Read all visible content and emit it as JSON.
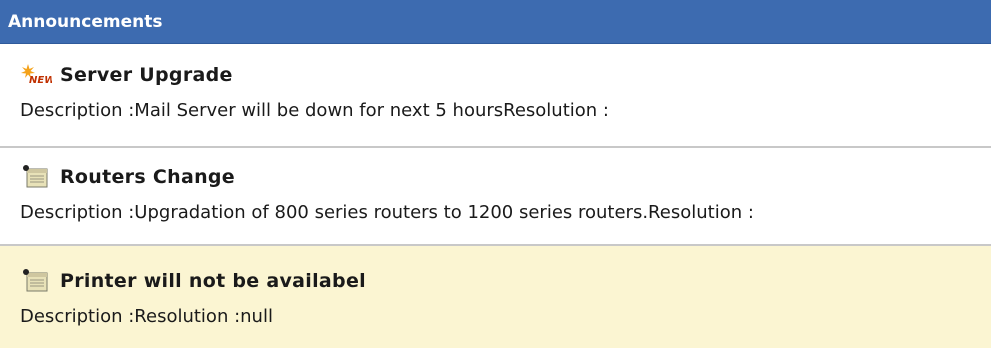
{
  "header": {
    "title": "Announcements"
  },
  "announcements": [
    {
      "title": "Server Upgrade",
      "description": "Description :Mail Server will be down for next 5 hoursResolution :",
      "icon": "new-badge-icon"
    },
    {
      "title": "Routers Change",
      "description": "Description :Upgradation of 800 series routers to 1200 series routers.Resolution :",
      "icon": "note-icon"
    },
    {
      "title": "Printer will not be availabel",
      "description": "Description :Resolution :null",
      "icon": "note-icon"
    }
  ],
  "colors": {
    "header_bg": "#3d6bb0",
    "highlight_bg": "#fbf5d2",
    "divider": "#c8c8c8"
  }
}
